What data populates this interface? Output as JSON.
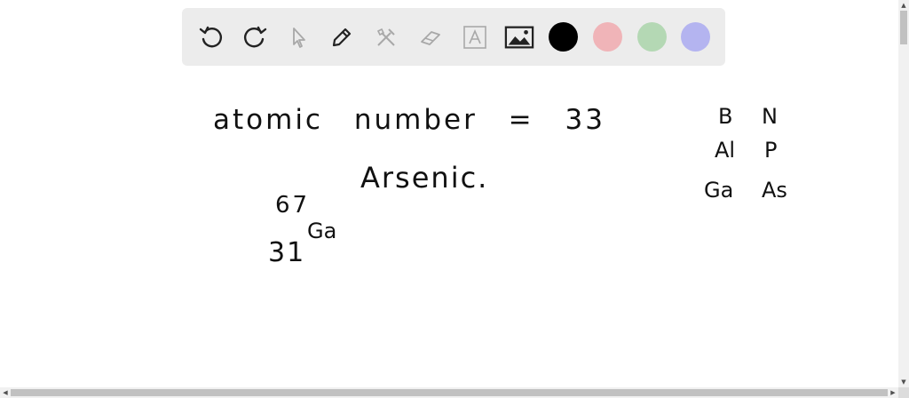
{
  "toolbar": {
    "tools": [
      {
        "name": "undo-icon"
      },
      {
        "name": "redo-icon"
      },
      {
        "name": "select-pointer-icon"
      },
      {
        "name": "pen-icon"
      },
      {
        "name": "tools-icon"
      },
      {
        "name": "eraser-icon"
      },
      {
        "name": "text-icon"
      },
      {
        "name": "image-icon"
      }
    ],
    "colors": [
      "#000000",
      "#f0b4b8",
      "#b4d8b4",
      "#b4b4f0"
    ]
  },
  "canvas": {
    "line1": "atomic number = 33",
    "line2": "Arsenic.",
    "mass_number": "67",
    "atomic_number": "31",
    "element_symbol": "Ga",
    "periodic_table": [
      [
        "B",
        "N"
      ],
      [
        "Al",
        "P"
      ],
      [
        "Ga",
        "As"
      ]
    ]
  },
  "scrollbars": {
    "left_arrow": "◀",
    "right_arrow": "▶",
    "up_arrow": "▲",
    "down_arrow": "▼"
  }
}
